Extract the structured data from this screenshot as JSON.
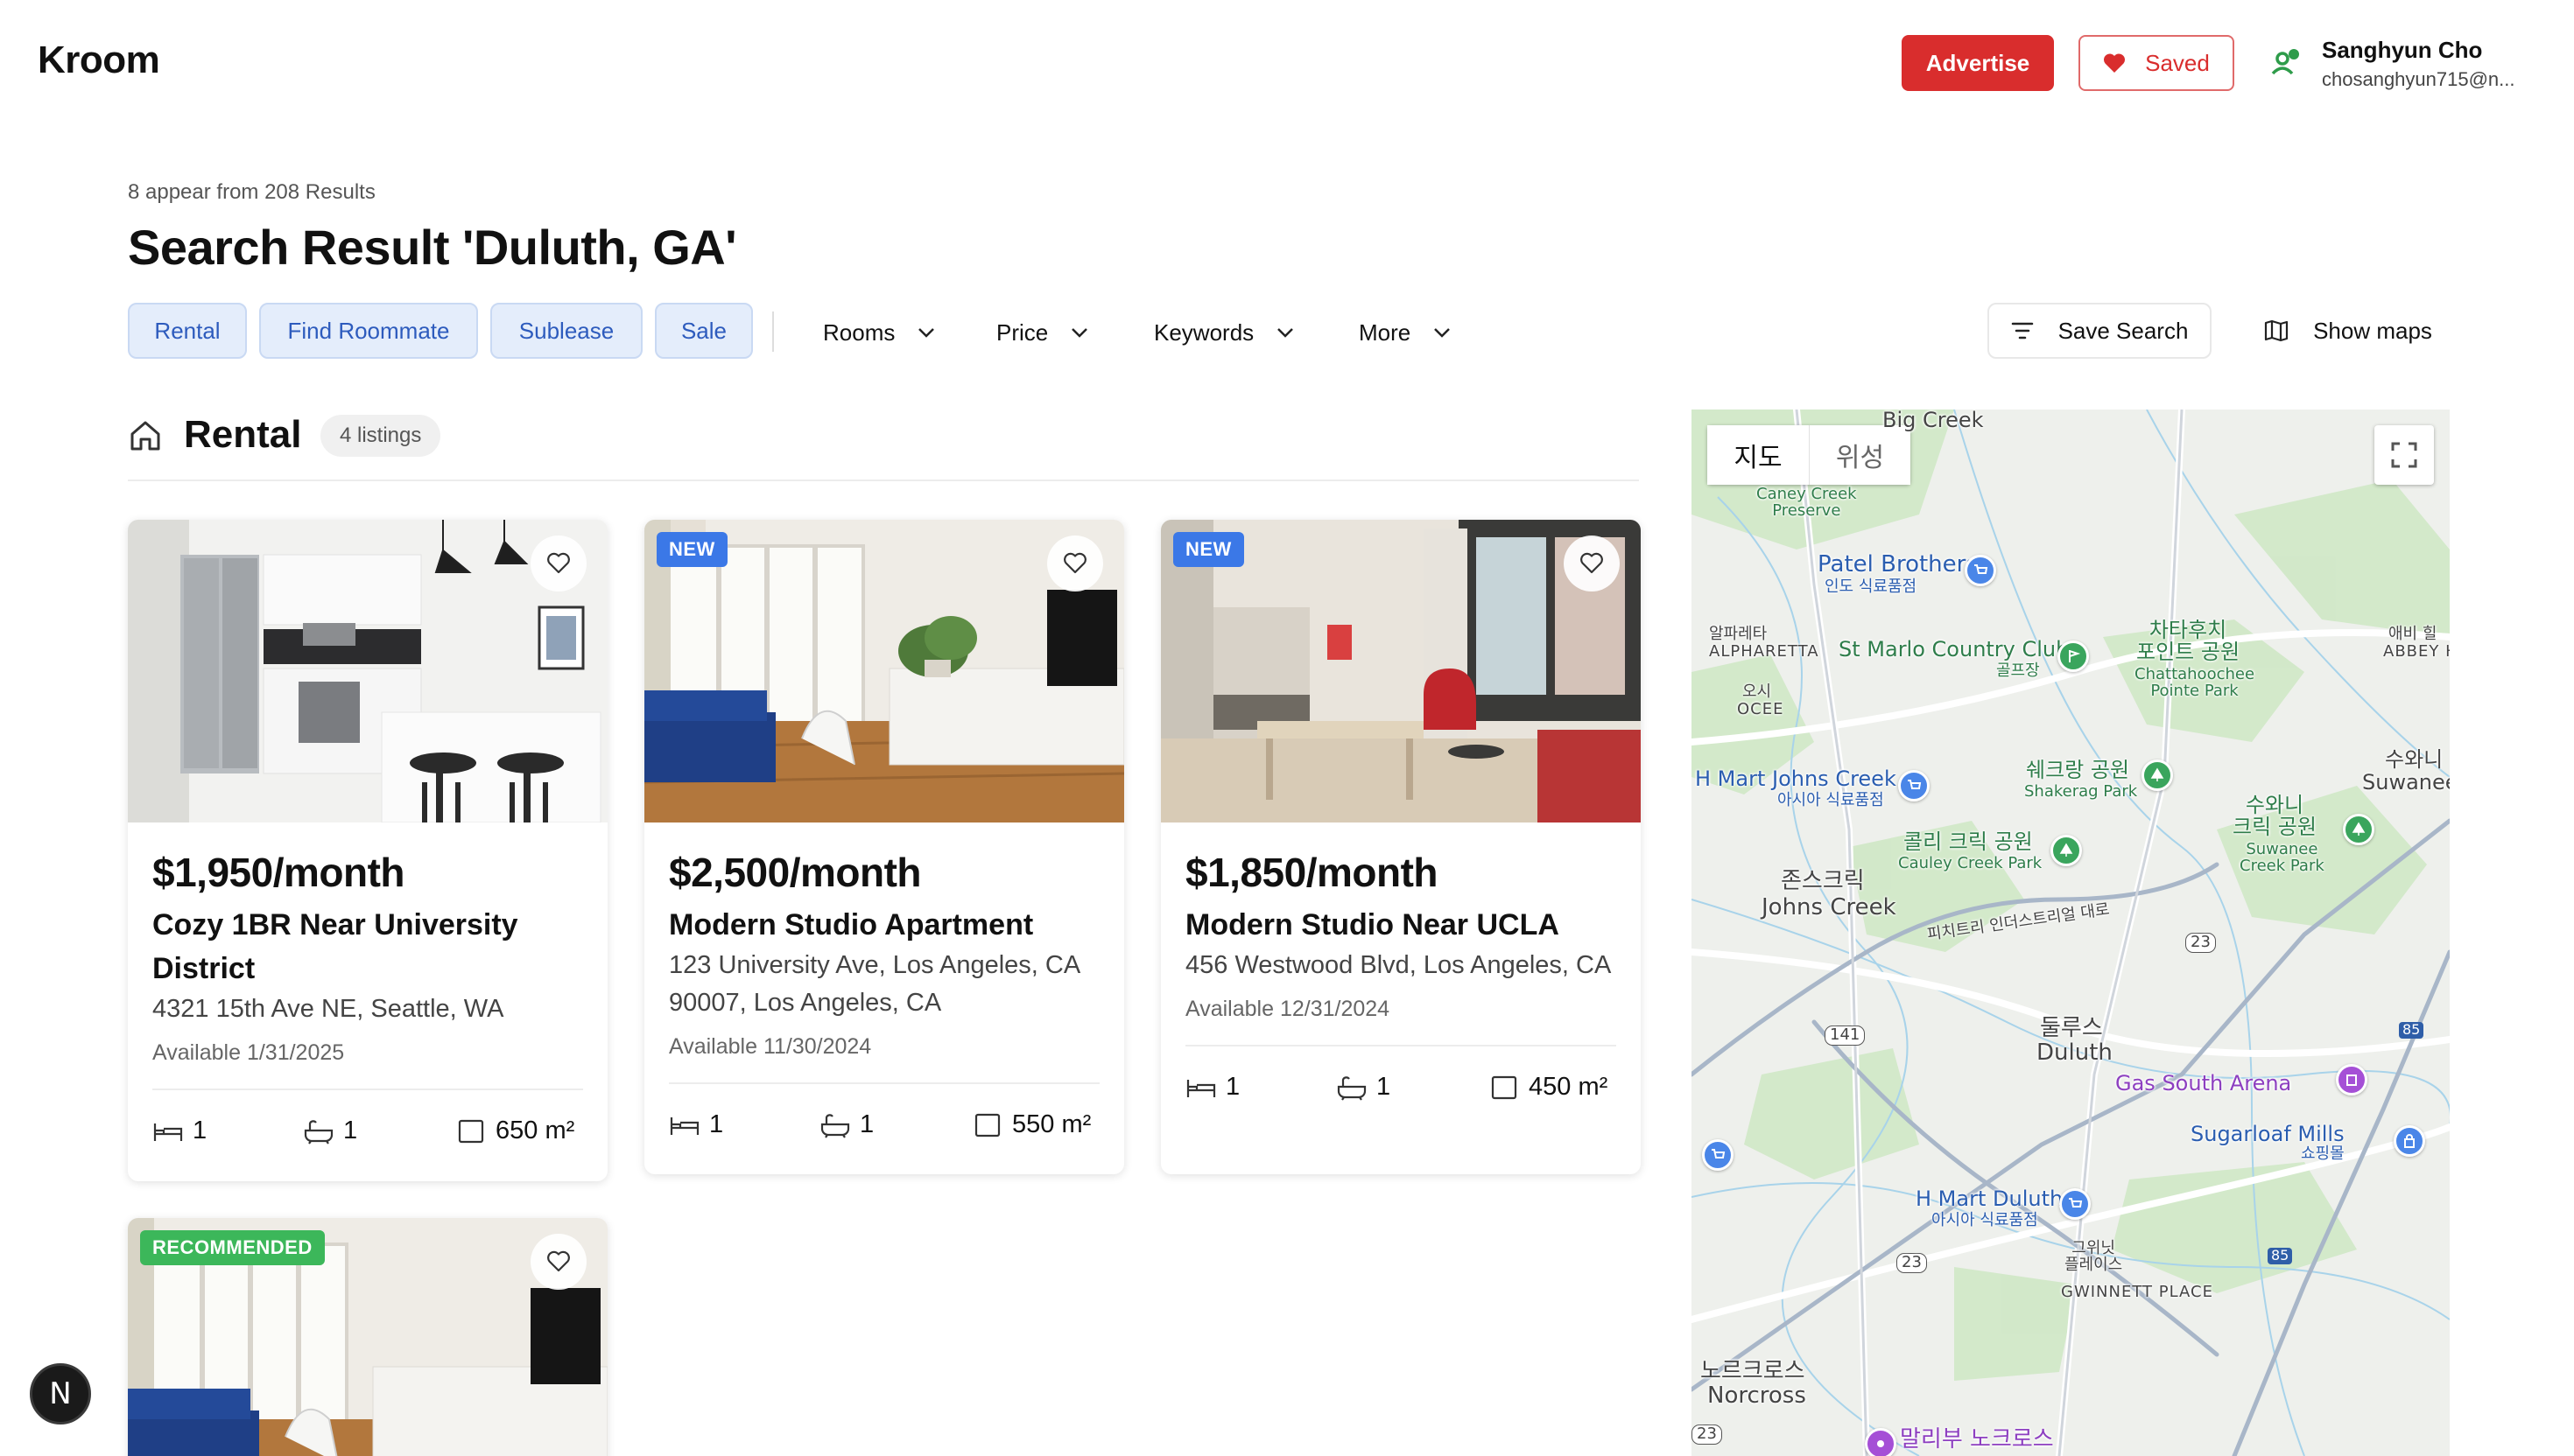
{
  "header": {
    "logo": "Kroom",
    "advertise_label": "Advertise",
    "saved_label": "Saved",
    "user_name": "Sanghyun Cho",
    "user_email": "chosanghyun715@n..."
  },
  "search": {
    "results_summary": "8 appear from 208 Results",
    "title": "Search Result 'Duluth, GA'"
  },
  "filters": {
    "chips": [
      "Rental",
      "Find Roommate",
      "Sublease",
      "Sale"
    ],
    "dropdowns": [
      "Rooms",
      "Price",
      "Keywords",
      "More"
    ],
    "save_search_label": "Save Search",
    "show_maps_label": "Show maps"
  },
  "section": {
    "title": "Rental",
    "count": "4 listings"
  },
  "listings": [
    {
      "badge": "",
      "price": "$1,950/month",
      "title": "Cozy 1BR Near University District",
      "address": "4321 15th Ave NE, Seattle, WA",
      "available": "Available 1/31/2025",
      "beds": "1",
      "baths": "1",
      "area": "650 m²"
    },
    {
      "badge": "NEW",
      "price": "$2,500/month",
      "title": "Modern Studio Apartment",
      "address": "123 University Ave, Los Angeles, CA 90007, Los Angeles, CA",
      "available": "Available 11/30/2024",
      "beds": "1",
      "baths": "1",
      "area": "550 m²"
    },
    {
      "badge": "NEW",
      "price": "$1,850/month",
      "title": "Modern Studio Near UCLA",
      "address": "456 Westwood Blvd, Los Angeles, CA",
      "available": "Available 12/31/2024",
      "beds": "1",
      "baths": "1",
      "area": "450 m²"
    },
    {
      "badge": "RECOMMENDED"
    }
  ],
  "map": {
    "tab_map": "지도",
    "tab_satellite": "위성",
    "labels": {
      "big_creek": "Big Creek",
      "caney_creek": "Caney Creek\nPreserve",
      "patel_brothers": "Patel Brothers",
      "patel_brothers_ko": "인도 식료품점",
      "alpharetta_ko": "알파레타",
      "alpharetta": "ALPHARETTA",
      "st_marlo": "St Marlo Country Club",
      "st_marlo_ko": "골프장",
      "chattahoochee_ko": "차타후치\n포인트 공원",
      "chattahoochee": "Chattahoochee\nPointe Park",
      "abbey_ko": "애비 힐",
      "abbey": "ABBEY HI",
      "oce_ko": "오시",
      "oce": "OCEE",
      "hmart_jc": "H Mart Johns Creek",
      "hmart_jc_ko": "아시아 식료품점",
      "shakerag_ko": "쉐크랑 공원",
      "shakerag": "Shakerag Park",
      "suwanee_ko": "수와니",
      "suwanee": "Suwanee",
      "cauley_ko": "콜리 크릭 공원",
      "cauley": "Cauley Creek Park",
      "suwanee_creek_ko": "수와니\n크릭 공원",
      "suwanee_creek": "Suwanee\nCreek Park",
      "johns_creek_ko": "존스크릭",
      "johns_creek": "Johns Creek",
      "pib_ko": "피치트리 인더스트리얼 대로",
      "duluth_ko": "둘루스",
      "duluth": "Duluth",
      "gas_south": "Gas South Arena",
      "sugarloaf": "Sugarloaf Mills",
      "sugarloaf_ko": "쇼핑몰",
      "hmart_duluth": "H Mart Duluth",
      "hmart_duluth_ko": "아시아 식료품점",
      "gwinnett_ko": "그위닛\n플레이스",
      "gwinnett": "GWINNETT PLACE",
      "norcross_ko": "노르크로스",
      "norcross": "Norcross",
      "maripu_ko": "말리부 노크로스",
      "r141": "141",
      "r23a": "23",
      "r23b": "23",
      "r85a": "85",
      "r85b": "85",
      "r23c": "23"
    }
  },
  "colors": {
    "primary_red": "#d92d2d",
    "chip_bg": "#e4edfb",
    "chip_text": "#2d5bbd",
    "badge_new": "#3b78e7",
    "badge_recommended": "#3cb75a"
  },
  "misc": {
    "n_bubble": "N"
  }
}
